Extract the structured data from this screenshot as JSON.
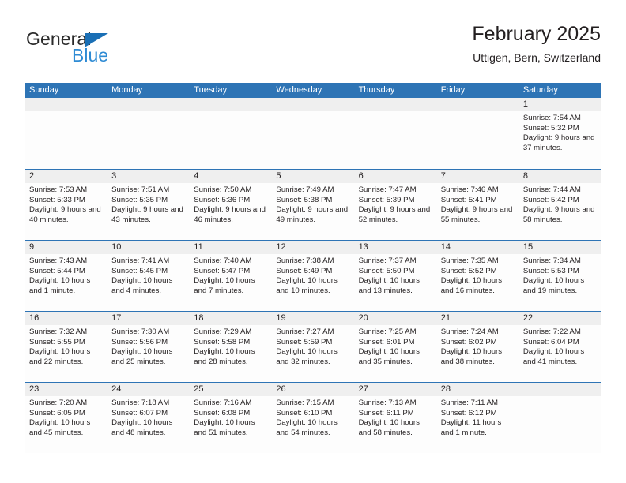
{
  "brand": {
    "name_top": "General",
    "name_bottom": "Blue",
    "accent_dark": "#1a6fb5",
    "accent_light": "#2e8bd4"
  },
  "header": {
    "title": "February 2025",
    "subtitle": "Uttigen, Bern, Switzerland"
  },
  "theme": {
    "header_blue": "#2e74b5",
    "daynum_band": "#efefef",
    "cell_background": "#fdfdfd",
    "text": "#231f20"
  },
  "calendar": {
    "weekdays": [
      "Sunday",
      "Monday",
      "Tuesday",
      "Wednesday",
      "Thursday",
      "Friday",
      "Saturday"
    ],
    "weeks": [
      [
        {
          "day": "",
          "empty": true
        },
        {
          "day": "",
          "empty": true
        },
        {
          "day": "",
          "empty": true
        },
        {
          "day": "",
          "empty": true
        },
        {
          "day": "",
          "empty": true
        },
        {
          "day": "",
          "empty": true
        },
        {
          "day": "1",
          "sunrise": "Sunrise: 7:54 AM",
          "sunset": "Sunset: 5:32 PM",
          "daylight": "Daylight: 9 hours and 37 minutes."
        }
      ],
      [
        {
          "day": "2",
          "sunrise": "Sunrise: 7:53 AM",
          "sunset": "Sunset: 5:33 PM",
          "daylight": "Daylight: 9 hours and 40 minutes."
        },
        {
          "day": "3",
          "sunrise": "Sunrise: 7:51 AM",
          "sunset": "Sunset: 5:35 PM",
          "daylight": "Daylight: 9 hours and 43 minutes."
        },
        {
          "day": "4",
          "sunrise": "Sunrise: 7:50 AM",
          "sunset": "Sunset: 5:36 PM",
          "daylight": "Daylight: 9 hours and 46 minutes."
        },
        {
          "day": "5",
          "sunrise": "Sunrise: 7:49 AM",
          "sunset": "Sunset: 5:38 PM",
          "daylight": "Daylight: 9 hours and 49 minutes."
        },
        {
          "day": "6",
          "sunrise": "Sunrise: 7:47 AM",
          "sunset": "Sunset: 5:39 PM",
          "daylight": "Daylight: 9 hours and 52 minutes."
        },
        {
          "day": "7",
          "sunrise": "Sunrise: 7:46 AM",
          "sunset": "Sunset: 5:41 PM",
          "daylight": "Daylight: 9 hours and 55 minutes."
        },
        {
          "day": "8",
          "sunrise": "Sunrise: 7:44 AM",
          "sunset": "Sunset: 5:42 PM",
          "daylight": "Daylight: 9 hours and 58 minutes."
        }
      ],
      [
        {
          "day": "9",
          "sunrise": "Sunrise: 7:43 AM",
          "sunset": "Sunset: 5:44 PM",
          "daylight": "Daylight: 10 hours and 1 minute."
        },
        {
          "day": "10",
          "sunrise": "Sunrise: 7:41 AM",
          "sunset": "Sunset: 5:45 PM",
          "daylight": "Daylight: 10 hours and 4 minutes."
        },
        {
          "day": "11",
          "sunrise": "Sunrise: 7:40 AM",
          "sunset": "Sunset: 5:47 PM",
          "daylight": "Daylight: 10 hours and 7 minutes."
        },
        {
          "day": "12",
          "sunrise": "Sunrise: 7:38 AM",
          "sunset": "Sunset: 5:49 PM",
          "daylight": "Daylight: 10 hours and 10 minutes."
        },
        {
          "day": "13",
          "sunrise": "Sunrise: 7:37 AM",
          "sunset": "Sunset: 5:50 PM",
          "daylight": "Daylight: 10 hours and 13 minutes."
        },
        {
          "day": "14",
          "sunrise": "Sunrise: 7:35 AM",
          "sunset": "Sunset: 5:52 PM",
          "daylight": "Daylight: 10 hours and 16 minutes."
        },
        {
          "day": "15",
          "sunrise": "Sunrise: 7:34 AM",
          "sunset": "Sunset: 5:53 PM",
          "daylight": "Daylight: 10 hours and 19 minutes."
        }
      ],
      [
        {
          "day": "16",
          "sunrise": "Sunrise: 7:32 AM",
          "sunset": "Sunset: 5:55 PM",
          "daylight": "Daylight: 10 hours and 22 minutes."
        },
        {
          "day": "17",
          "sunrise": "Sunrise: 7:30 AM",
          "sunset": "Sunset: 5:56 PM",
          "daylight": "Daylight: 10 hours and 25 minutes."
        },
        {
          "day": "18",
          "sunrise": "Sunrise: 7:29 AM",
          "sunset": "Sunset: 5:58 PM",
          "daylight": "Daylight: 10 hours and 28 minutes."
        },
        {
          "day": "19",
          "sunrise": "Sunrise: 7:27 AM",
          "sunset": "Sunset: 5:59 PM",
          "daylight": "Daylight: 10 hours and 32 minutes."
        },
        {
          "day": "20",
          "sunrise": "Sunrise: 7:25 AM",
          "sunset": "Sunset: 6:01 PM",
          "daylight": "Daylight: 10 hours and 35 minutes."
        },
        {
          "day": "21",
          "sunrise": "Sunrise: 7:24 AM",
          "sunset": "Sunset: 6:02 PM",
          "daylight": "Daylight: 10 hours and 38 minutes."
        },
        {
          "day": "22",
          "sunrise": "Sunrise: 7:22 AM",
          "sunset": "Sunset: 6:04 PM",
          "daylight": "Daylight: 10 hours and 41 minutes."
        }
      ],
      [
        {
          "day": "23",
          "sunrise": "Sunrise: 7:20 AM",
          "sunset": "Sunset: 6:05 PM",
          "daylight": "Daylight: 10 hours and 45 minutes."
        },
        {
          "day": "24",
          "sunrise": "Sunrise: 7:18 AM",
          "sunset": "Sunset: 6:07 PM",
          "daylight": "Daylight: 10 hours and 48 minutes."
        },
        {
          "day": "25",
          "sunrise": "Sunrise: 7:16 AM",
          "sunset": "Sunset: 6:08 PM",
          "daylight": "Daylight: 10 hours and 51 minutes."
        },
        {
          "day": "26",
          "sunrise": "Sunrise: 7:15 AM",
          "sunset": "Sunset: 6:10 PM",
          "daylight": "Daylight: 10 hours and 54 minutes."
        },
        {
          "day": "27",
          "sunrise": "Sunrise: 7:13 AM",
          "sunset": "Sunset: 6:11 PM",
          "daylight": "Daylight: 10 hours and 58 minutes."
        },
        {
          "day": "28",
          "sunrise": "Sunrise: 7:11 AM",
          "sunset": "Sunset: 6:12 PM",
          "daylight": "Daylight: 11 hours and 1 minute."
        },
        {
          "day": "",
          "empty": true
        }
      ]
    ]
  }
}
